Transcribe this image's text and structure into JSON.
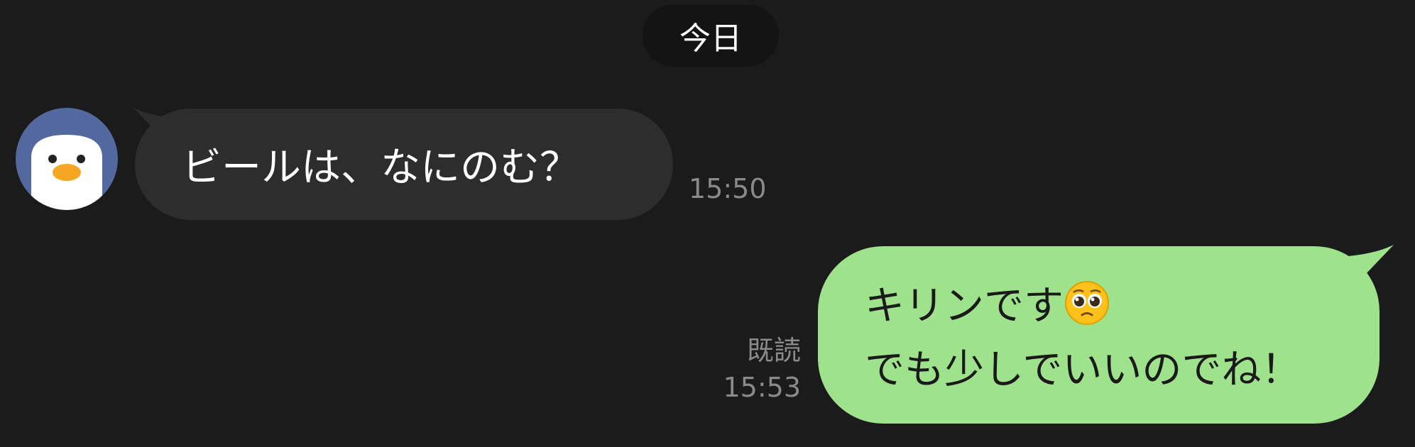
{
  "date_divider": {
    "label": "今日"
  },
  "messages": [
    {
      "direction": "incoming",
      "sender_avatar": "penguin-avatar",
      "text": "ビールは、なにのむ？",
      "time": "15:50"
    },
    {
      "direction": "outgoing",
      "line1": "キリンです",
      "emoji": "pleading-face-emoji",
      "line2": "でも少しでいいのでね！",
      "read_label": "既読",
      "time": "15:53"
    }
  ],
  "colors": {
    "background": "#1b1b1b",
    "incoming_bubble": "#2d2d2d",
    "outgoing_bubble": "#9fe28c",
    "avatar_bg": "#5468a0",
    "meta_text": "#8a8a8a"
  }
}
